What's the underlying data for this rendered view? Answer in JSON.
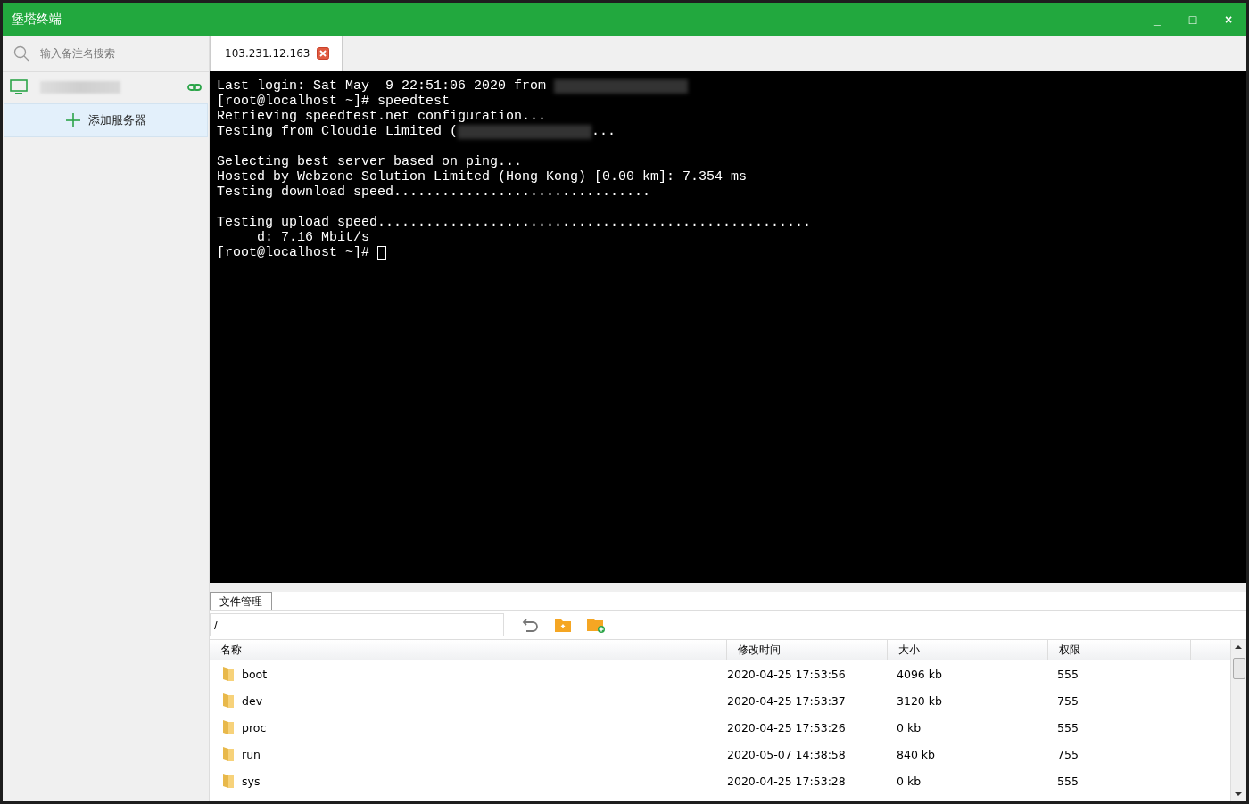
{
  "window": {
    "title": "堡塔终端",
    "controls": [
      "_",
      "□",
      "×"
    ]
  },
  "sidebar": {
    "search": {
      "placeholder": "输入备注名搜索"
    },
    "add_button": "添加服务器"
  },
  "tabs": [
    {
      "label": "103.231.12.163",
      "selected": true
    }
  ],
  "terminal": {
    "lines": [
      {
        "kind": "redacted",
        "text": "Last login: Sat May  9 22:51:06 2020 from "
      },
      {
        "kind": "plain",
        "text": "[root@localhost ~]# speedtest"
      },
      {
        "kind": "plain",
        "text": "Retrieving speedtest.net configuration..."
      },
      {
        "kind": "redacted",
        "text": "Testing from Cloudie Limited (",
        "after": "..."
      },
      {
        "kind": "blank"
      },
      {
        "kind": "plain",
        "text": "Selecting best server based on ping..."
      },
      {
        "kind": "plain",
        "text": "Hosted by Webzone Solution Limited (Hong Kong) [0.00 km]: 7.354 ms"
      },
      {
        "kind": "plain",
        "text": "Testing download speed................................"
      },
      {
        "kind": "blank"
      },
      {
        "kind": "plain",
        "text": "Testing upload speed......................................................"
      },
      {
        "kind": "plain",
        "text": "     d: 7.16 Mbit/s"
      },
      {
        "kind": "prompt",
        "text": "[root@localhost ~]# "
      }
    ]
  },
  "file_manager": {
    "tab": "文件管理",
    "path": "/",
    "columns": [
      "名称",
      "修改时间",
      "大小",
      "权限"
    ],
    "rows": [
      {
        "name": "boot",
        "modified": "2020-04-25 17:53:56",
        "size": "4096 kb",
        "permissions": "555"
      },
      {
        "name": "dev",
        "modified": "2020-04-25 17:53:37",
        "size": "3120 kb",
        "permissions": "755"
      },
      {
        "name": "proc",
        "modified": "2020-04-25 17:53:26",
        "size": "0 kb",
        "permissions": "555"
      },
      {
        "name": "run",
        "modified": "2020-05-07 14:38:58",
        "size": "840 kb",
        "permissions": "755"
      },
      {
        "name": "sys",
        "modified": "2020-04-25 17:53:28",
        "size": "0 kb",
        "permissions": "555"
      }
    ]
  }
}
